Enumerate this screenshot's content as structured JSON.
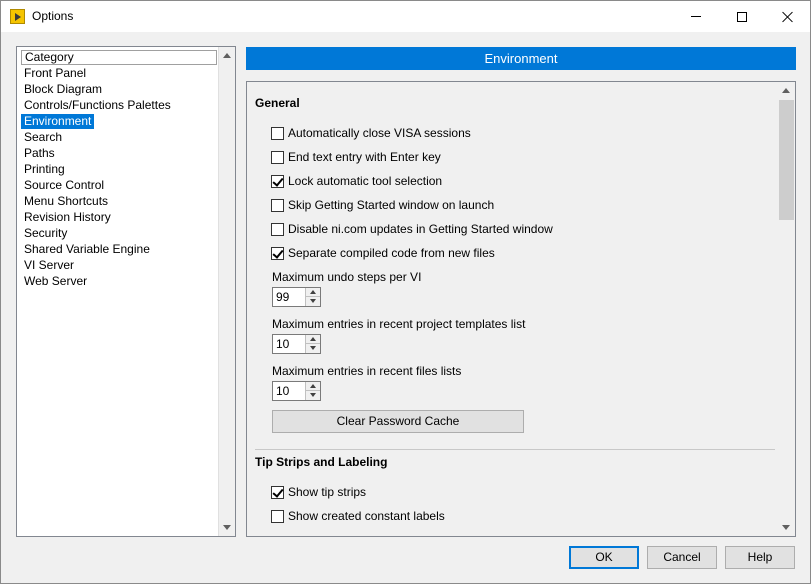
{
  "window": {
    "title": "Options"
  },
  "category": {
    "header": "Category",
    "items": [
      "Front Panel",
      "Block Diagram",
      "Controls/Functions Palettes",
      "Environment",
      "Search",
      "Paths",
      "Printing",
      "Source Control",
      "Menu Shortcuts",
      "Revision History",
      "Security",
      "Shared Variable Engine",
      "VI Server",
      "Web Server"
    ],
    "selected": "Environment"
  },
  "banner": {
    "title": "Environment"
  },
  "general": {
    "title": "General",
    "checks": [
      {
        "label": "Automatically close VISA sessions",
        "checked": false
      },
      {
        "label": "End text entry with Enter key",
        "checked": false
      },
      {
        "label": "Lock automatic tool selection",
        "checked": true
      },
      {
        "label": "Skip Getting Started window on launch",
        "checked": false
      },
      {
        "label": "Disable ni.com updates in Getting Started window",
        "checked": false
      },
      {
        "label": "Separate compiled code from new files",
        "checked": true
      }
    ],
    "undo_label": "Maximum undo steps per VI",
    "undo_value": "99",
    "templates_label": "Maximum entries in recent project templates list",
    "templates_value": "10",
    "files_label": "Maximum entries in recent files lists",
    "files_value": "10",
    "clear_button": "Clear Password Cache"
  },
  "tips": {
    "title": "Tip Strips and Labeling",
    "checks": [
      {
        "label": "Show tip strips",
        "checked": true
      },
      {
        "label": "Show created constant labels",
        "checked": false
      }
    ]
  },
  "footer": {
    "ok": "OK",
    "cancel": "Cancel",
    "help": "Help"
  },
  "colors": {
    "accent": "#0078d7"
  }
}
